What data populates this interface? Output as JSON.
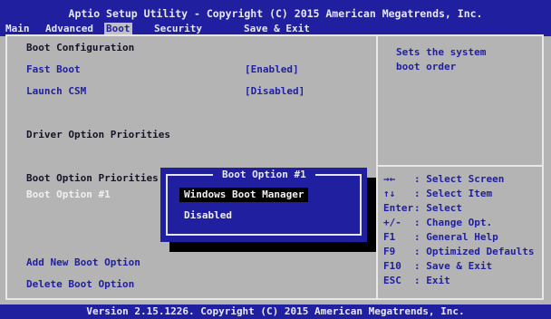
{
  "header": {
    "title": "Aptio Setup Utility - Copyright (C) 2015 American Megatrends, Inc.",
    "tabs": [
      "Main",
      "Advanced",
      "Boot",
      "Security",
      "Save & Exit"
    ],
    "active_tab": "Boot"
  },
  "left": {
    "boot_configuration": "Boot Configuration",
    "fast_boot_label": "Fast Boot",
    "fast_boot_value": "[Enabled]",
    "launch_csm_label": "Launch CSM",
    "launch_csm_value": "[Disabled]",
    "driver_option_priorities": "Driver Option Priorities",
    "boot_option_priorities": "Boot Option Priorities",
    "boot_option_1": "Boot Option #1",
    "add_new_boot_option": "Add New Boot Option",
    "delete_boot_option": "Delete Boot Option"
  },
  "help": {
    "line1": "Sets the system",
    "line2": "boot order"
  },
  "keys": [
    {
      "key": "→←",
      "desc": ": Select Screen"
    },
    {
      "key": "↑↓",
      "desc": ": Select Item"
    },
    {
      "key": "Enter",
      "desc": ": Select"
    },
    {
      "key": "+/-",
      "desc": ": Change Opt."
    },
    {
      "key": "F1",
      "desc": ": General Help"
    },
    {
      "key": "F9",
      "desc": ": Optimized Defaults"
    },
    {
      "key": "F10",
      "desc": ": Save & Exit"
    },
    {
      "key": "ESC",
      "desc": ": Exit"
    }
  ],
  "popup": {
    "title": "Boot Option #1",
    "options": [
      "Windows Boot Manager",
      "Disabled"
    ],
    "selected": "Windows Boot Manager"
  },
  "footer": "Version 2.15.1226. Copyright (C) 2015 American Megatrends, Inc.",
  "colors": {
    "background": "#b4b4b4",
    "header_blue": "#1f1fa0",
    "text_blue": "#1f1fa0",
    "highlight_text": "#f0f0f0"
  }
}
